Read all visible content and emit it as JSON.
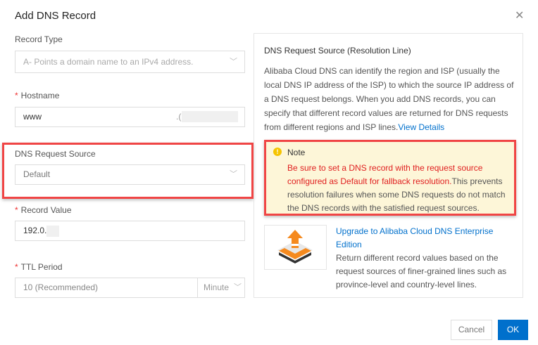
{
  "dialog": {
    "title": "Add DNS Record",
    "close_icon": "close-icon"
  },
  "form": {
    "record_type": {
      "label": "Record Type",
      "value": "A- Points a domain name to an IPv4 address."
    },
    "hostname": {
      "label": "Hostname",
      "value": "www",
      "suffix": ".("
    },
    "request_source": {
      "label": "DNS Request Source",
      "value": "Default"
    },
    "record_value": {
      "label": "Record Value",
      "value": "192.0."
    },
    "ttl": {
      "label": "TTL Period",
      "value": "10 (Recommended)",
      "unit": "Minute"
    },
    "required_mark": "*"
  },
  "info": {
    "title": "DNS Request Source (Resolution Line)",
    "text": "Alibaba Cloud DNS can identify the region and ISP (usually the local DNS IP address of the ISP) to which the source IP address of a DNS request belongs. When you add DNS records, you can specify that different record values are returned for DNS requests from different regions and ISP lines.",
    "link": "View Details",
    "note": {
      "title": "Note",
      "highlight": "Be sure to set a DNS record with the request source configured as Default for fallback resolution.",
      "text": "This prevents resolution failures when some DNS requests do not match the DNS records with the satisfied request sources."
    },
    "upgrade": {
      "link": "Upgrade to Alibaba Cloud DNS Enterprise Edition",
      "text": "Return different record values based on the request sources of finer-grained lines such as province-level and country-level lines."
    }
  },
  "footer": {
    "cancel": "Cancel",
    "ok": "OK"
  },
  "colors": {
    "accent": "#0070cc",
    "highlight_border": "#f04545",
    "note_bg": "#fdf6d8"
  }
}
